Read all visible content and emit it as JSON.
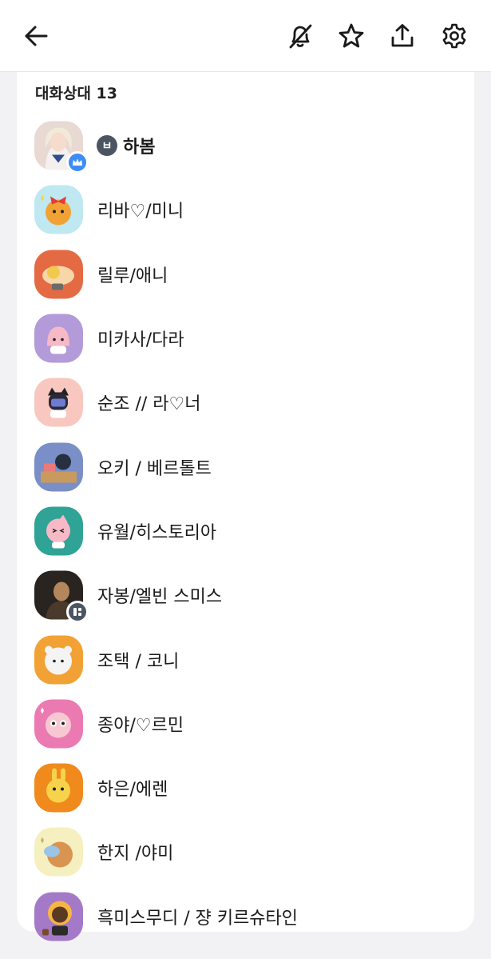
{
  "header": {
    "back_icon": "arrow-left-icon",
    "mute_icon": "bell-off-icon",
    "favorite_icon": "star-icon",
    "share_icon": "share-icon",
    "settings_icon": "gear-icon"
  },
  "participants": {
    "title": "대화상대 13",
    "host_marker": "ㅂ",
    "host_badge_color": "#3d8df5",
    "items": [
      {
        "name": "하봄",
        "avatar_color": "#e8d9d3"
      },
      {
        "name": "리바♡/미니",
        "avatar_color": "#bfe8f0"
      },
      {
        "name": "릴루/애니",
        "avatar_color": "#e46a44"
      },
      {
        "name": "미카사/다라",
        "avatar_color": "#b39ad8"
      },
      {
        "name": "순조 // 라♡너",
        "avatar_color": "#f8c8c0"
      },
      {
        "name": "오키 / 베르톨트",
        "avatar_color": "#7a8fc8"
      },
      {
        "name": "유월/히스토리아",
        "avatar_color": "#2fa396"
      },
      {
        "name": "자봉/엘빈 스미스",
        "avatar_color": "#2a2420"
      },
      {
        "name": "조택 / 코니",
        "avatar_color": "#f2a234"
      },
      {
        "name": "종야/♡르민",
        "avatar_color": "#ec7ab2"
      },
      {
        "name": "하은/에렌",
        "avatar_color": "#f08a1c"
      },
      {
        "name": "한지 /야미",
        "avatar_color": "#f6f0c0"
      },
      {
        "name": "흑미스무디 / 쟝 키르슈타인",
        "avatar_color": "#a47ac8"
      }
    ]
  }
}
